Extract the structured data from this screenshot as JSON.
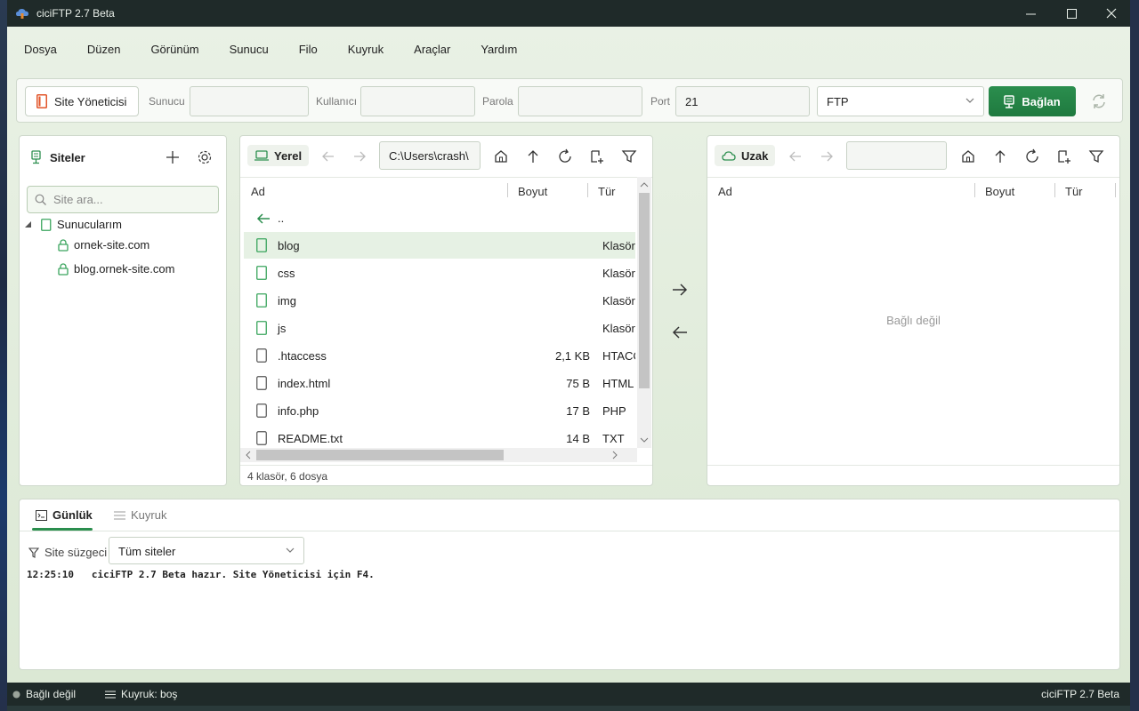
{
  "window": {
    "title": "ciciFTP 2.7 Beta"
  },
  "menu": [
    "Dosya",
    "Düzen",
    "Görünüm",
    "Sunucu",
    "Filo",
    "Kuyruk",
    "Araçlar",
    "Yardım"
  ],
  "connection": {
    "site_manager_label": "Site Yöneticisi",
    "host_label": "Sunucu",
    "host_value": "",
    "user_label": "Kullanıcı",
    "user_value": "",
    "password_label": "Parola",
    "password_value": "",
    "port_label": "Port",
    "port_value": "21",
    "protocol": "FTP",
    "connect_label": "Bağlan"
  },
  "sites": {
    "title": "Siteler",
    "search_placeholder": "Site ara...",
    "folder": "Sunucularım",
    "items": [
      "ornek-site.com",
      "blog.ornek-site.com"
    ]
  },
  "local": {
    "tab_label": "Yerel",
    "path": "C:\\Users\\crash\\",
    "columns": {
      "name": "Ad",
      "size": "Boyut",
      "type": "Tür"
    },
    "parent": "..",
    "files": [
      {
        "name": "blog",
        "size": "",
        "type": "Klasör",
        "kind": "folder"
      },
      {
        "name": "css",
        "size": "",
        "type": "Klasör",
        "kind": "folder"
      },
      {
        "name": "img",
        "size": "",
        "type": "Klasör",
        "kind": "folder"
      },
      {
        "name": "js",
        "size": "",
        "type": "Klasör",
        "kind": "folder"
      },
      {
        "name": ".htaccess",
        "size": "2,1 KB",
        "type": "HTACCESS",
        "kind": "file"
      },
      {
        "name": "index.html",
        "size": "75 B",
        "type": "HTML",
        "kind": "file"
      },
      {
        "name": "info.php",
        "size": "17 B",
        "type": "PHP",
        "kind": "file"
      },
      {
        "name": "README.txt",
        "size": "14 B",
        "type": "TXT",
        "kind": "file"
      }
    ],
    "summary": "4 klasör, 6 dosya"
  },
  "remote": {
    "tab_label": "Uzak",
    "path": "",
    "columns": {
      "name": "Ad",
      "size": "Boyut",
      "type": "Tür"
    },
    "empty_text": "Bağlı değil"
  },
  "log": {
    "tab_log": "Günlük",
    "tab_queue": "Kuyruk",
    "filter_label": "Site süzgeci",
    "filter_value": "Tüm siteler",
    "lines": [
      "12:25:10   ciciFTP 2.7 Beta hazır. Site Yöneticisi için F4."
    ]
  },
  "statusbar": {
    "connection": "Bağlı değil",
    "queue": "Kuyruk: boş",
    "version": "ciciFTP 2.7 Beta"
  },
  "colors": {
    "accent": "#2b8e4e",
    "titlebar": "#1f2a29",
    "background": "#dfe9da",
    "folder_icon": "#3aa55d"
  }
}
